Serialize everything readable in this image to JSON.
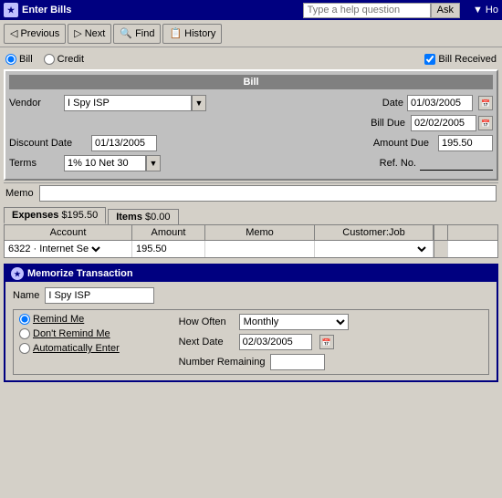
{
  "titleBar": {
    "icon": "★",
    "title": "Enter Bills",
    "helpPlaceholder": "Type a help question",
    "askLabel": "Ask",
    "arrowLabel": "▼ Ho"
  },
  "toolbar": {
    "previousLabel": "Previous",
    "nextLabel": "Next",
    "findLabel": "Find",
    "historyLabel": "History"
  },
  "form": {
    "billLabel": "Bill",
    "creditLabel": "Credit",
    "billReceivedLabel": "Bill Received",
    "sectionTitle": "Bill",
    "vendorLabel": "Vendor",
    "vendorValue": "I Spy ISP",
    "dateLabel": "Date",
    "dateValue": "01/03/2005",
    "billDueLabel": "Bill Due",
    "billDueValue": "02/02/2005",
    "discountDateLabel": "Discount Date",
    "discountDateValue": "01/13/2005",
    "amountDueLabel": "Amount Due",
    "amountDueValue": "195.50",
    "termsLabel": "Terms",
    "termsValue": "1% 10 Net 30",
    "refNoLabel": "Ref. No.",
    "memoLabel": "Memo"
  },
  "tabs": {
    "expensesLabel": "Expenses",
    "expensesAmount": "$195.50",
    "itemsLabel": "Items",
    "itemsAmount": "$0.00"
  },
  "table": {
    "headers": [
      "Account",
      "Amount",
      "Memo",
      "Customer:Job"
    ],
    "rows": [
      {
        "account": "6322 · Internet Se",
        "amount": "195.50",
        "memo": "",
        "customerJob": ""
      }
    ]
  },
  "memorize": {
    "title": "Memorize Transaction",
    "nameLabel": "Name",
    "nameValue": "I Spy ISP",
    "remindMeLabel": "Remind Me",
    "dontRemindLabel": "Don't Remind Me",
    "autoEnterLabel": "Automatically Enter",
    "howOftenLabel": "How Often",
    "howOftenValue": "Monthly",
    "nextDateLabel": "Next Date",
    "nextDateValue": "02/03/2005",
    "numberRemainingLabel": "Number Remaining"
  }
}
